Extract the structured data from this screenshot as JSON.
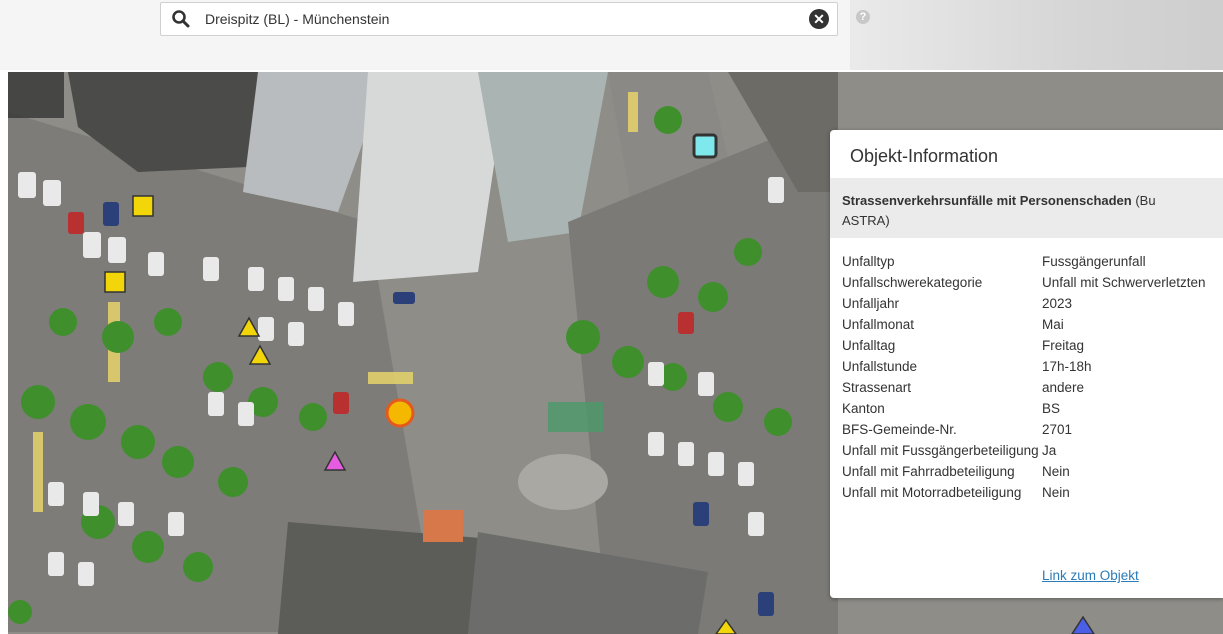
{
  "search": {
    "value": "Dreispitz (BL) - Münchenstein",
    "search_icon": "search-icon",
    "clear_icon": "clear-icon",
    "help_icon": "help-icon",
    "help_glyph": "?",
    "clear_glyph": "✕"
  },
  "map": {
    "markers": [
      {
        "type": "square",
        "color": "#f2d60a"
      },
      {
        "type": "square",
        "color": "#f2d60a"
      },
      {
        "type": "square",
        "color": "#7fe8ec"
      },
      {
        "type": "triangle",
        "color": "#f2d60a"
      },
      {
        "type": "triangle",
        "color": "#f2d60a"
      },
      {
        "type": "triangle",
        "color": "#e55ce0"
      },
      {
        "type": "triangle",
        "color": "#f2d60a"
      },
      {
        "type": "triangle",
        "color": "#4a5ee6"
      },
      {
        "type": "circle",
        "color": "#f5b800"
      }
    ]
  },
  "panel": {
    "title": "Objekt-Information",
    "layer_name_bold": "Strassenverkehrsunfälle mit Personenschaden",
    "layer_name_rest": " (Bu",
    "layer_name_line2": "ASTRA)",
    "attributes": [
      {
        "key": "Unfalltyp",
        "value": "Fussgängerunfall"
      },
      {
        "key": "Unfallschwerekategorie",
        "value": "Unfall mit Schwerverletzten"
      },
      {
        "key": "Unfalljahr",
        "value": "2023"
      },
      {
        "key": "Unfallmonat",
        "value": "Mai"
      },
      {
        "key": "Unfalltag",
        "value": "Freitag"
      },
      {
        "key": "Unfallstunde",
        "value": "17h-18h"
      },
      {
        "key": "Strassenart",
        "value": "andere"
      },
      {
        "key": "Kanton",
        "value": "BS"
      },
      {
        "key": "BFS-Gemeinde-Nr.",
        "value": "2701"
      },
      {
        "key": "Unfall mit Fussgängerbeteiligung",
        "value": "Ja"
      },
      {
        "key": "Unfall mit Fahrradbeteiligung",
        "value": "Nein"
      },
      {
        "key": "Unfall mit Motorradbeteiligung",
        "value": "Nein"
      }
    ],
    "link_label": "Link zum Objekt"
  }
}
